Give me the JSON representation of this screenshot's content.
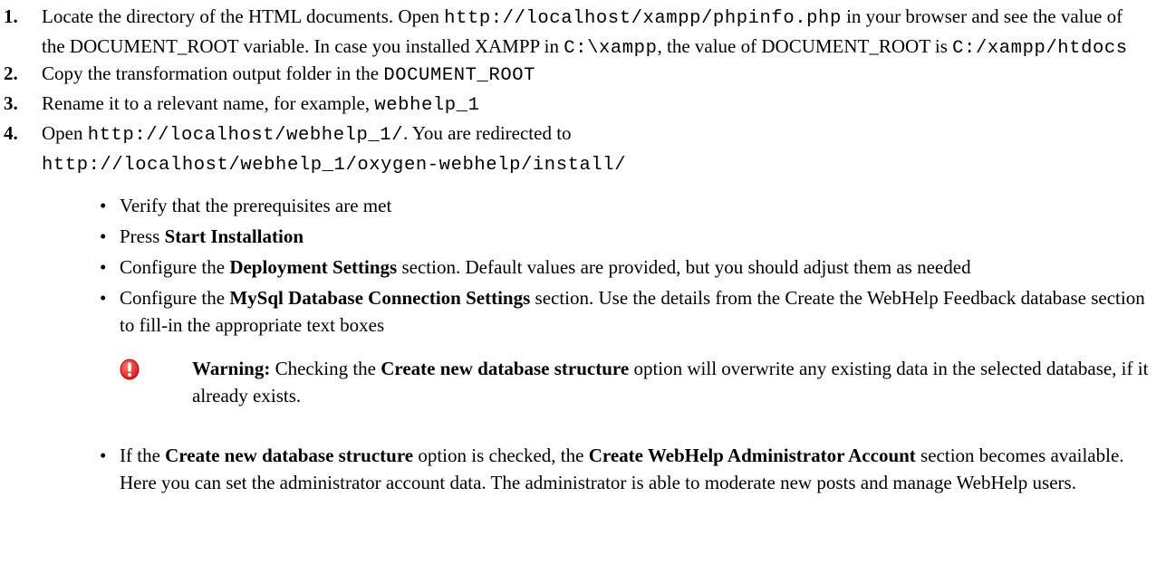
{
  "steps": [
    {
      "num": "1.",
      "a": "Locate the directory of the HTML documents. Open ",
      "code1": "http://localhost/xampp/phpinfo.php",
      "b": " in your browser and see the value of the DOCUMENT_ROOT variable. In case you installed XAMPP in ",
      "code2": "C:\\xampp",
      "c": ", the value of DOCUMENT_ROOT is ",
      "code3": "C:/xampp/htdocs"
    },
    {
      "num": "2.",
      "a": "Copy the transformation output folder in the ",
      "code1": "DOCUMENT_ROOT"
    },
    {
      "num": "3.",
      "a": "Rename it to a relevant name, for example, ",
      "code1": "webhelp_1"
    },
    {
      "num": "4.",
      "a": "Open ",
      "code1": "http://localhost/webhelp_1/",
      "b": ". You are redirected to ",
      "code2": "http://localhost/webhelp_1/oxygen-webhelp/install/"
    }
  ],
  "bullet": "•",
  "subs": [
    {
      "text": "Verify that the prerequisites are met"
    },
    {
      "pre": "Press ",
      "bold": "Start Installation"
    },
    {
      "pre": "Configure the ",
      "bold": "Deployment Settings",
      "post": " section. Default values are provided, but you should adjust them as needed"
    },
    {
      "pre": "Configure the ",
      "bold": "MySql Database Connection Settings",
      "post": " section. Use the details from the Create the WebHelp Feedback database section to fill-in the appropriate text boxes"
    }
  ],
  "warning": {
    "label": "Warning:",
    "a": " Checking the ",
    "bold": "Create new database structure",
    "b": " option will overwrite any existing data in the selected database, if it already exists.",
    "icon": "warning-exclamation-icon",
    "icon_color": "#e8262a"
  },
  "last_sub": {
    "a": "If the ",
    "bold1": "Create new database structure",
    "b": " option is checked, the ",
    "bold2": "Create WebHelp Administrator Account",
    "c": " section becomes available. Here you can set the administrator account data. The administrator is able to moderate new posts and manage WebHelp users."
  }
}
